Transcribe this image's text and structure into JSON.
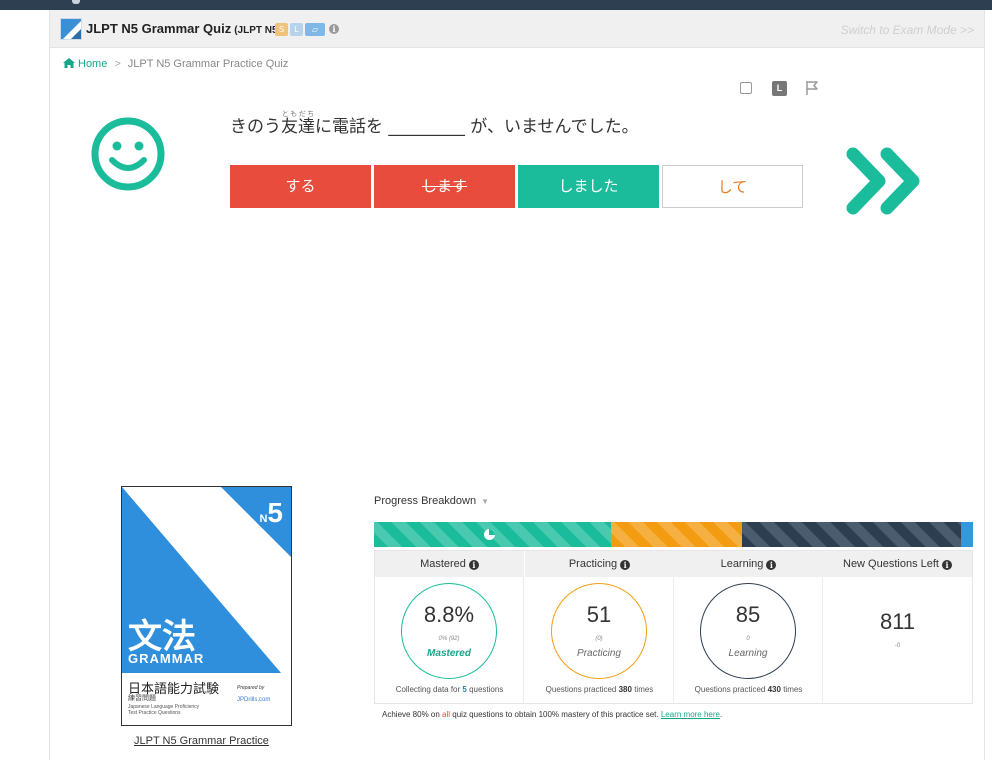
{
  "header": {
    "title": "JLPT N5 Grammar Quiz",
    "subtitle": "(JLPT N5)",
    "badges": [
      "S",
      "L",
      "▱"
    ],
    "exam_mode": "Switch to Exam Mode >>"
  },
  "breadcrumb": {
    "home": "Home",
    "separator": ">",
    "current": "JLPT N5 Grammar Practice Quiz"
  },
  "tools": {
    "level_badge": "L"
  },
  "question": {
    "before": "きのう",
    "ruby_base": "友達",
    "ruby_text": "ともだち",
    "after": "に電話を _________ が、いませんでした。"
  },
  "answers": [
    {
      "label": "する",
      "state": "wrong"
    },
    {
      "label": "します",
      "state": "wrong-struck"
    },
    {
      "label": "しました",
      "state": "correct"
    },
    {
      "label": "して",
      "state": "unselected"
    }
  ],
  "book": {
    "level": "5",
    "level_prefix": "N",
    "kanji": "文法",
    "grammar": "GRAMMAR",
    "jp_title": "日本語能力試験",
    "jp_sub": "練習問題",
    "en_sub": "Japanese Language Proficiency Test Practice Questions",
    "prepared": "Prepared by",
    "brand": "JPDrills.com",
    "link": "JLPT N5 Grammar Practice"
  },
  "progress": {
    "title": "Progress Breakdown",
    "bar_fractions": {
      "mastered": 0.395,
      "practicing": 0.22,
      "learning": 0.365,
      "new": 0.02
    },
    "colors": {
      "mastered": "#1abc9c",
      "practicing": "#f39c12",
      "learning": "#2c3e50",
      "new": "#3498db"
    },
    "columns": [
      {
        "header": "Mastered",
        "value": "8.8%",
        "sub": "0% (92)",
        "label": "Mastered",
        "foot_pre": "Collecting data for ",
        "foot_num": "5",
        "foot_post": " questions"
      },
      {
        "header": "Practicing",
        "value": "51",
        "sub": "(0)",
        "label": "Practicing",
        "foot_pre": "Questions practiced ",
        "foot_num": "380",
        "foot_post": " times"
      },
      {
        "header": "Learning",
        "value": "85",
        "sub": "0",
        "label": "Learning",
        "foot_pre": "Questions practiced ",
        "foot_num": "430",
        "foot_post": " times"
      },
      {
        "header": "New Questions Left",
        "value": "811",
        "sub": "-0"
      }
    ],
    "achieve_pre": "Achieve 80% on ",
    "achieve_all": "all",
    "achieve_mid": " quiz questions to obtain 100% mastery of this practice set. ",
    "achieve_link": "Learn more here",
    "achieve_end": "."
  }
}
